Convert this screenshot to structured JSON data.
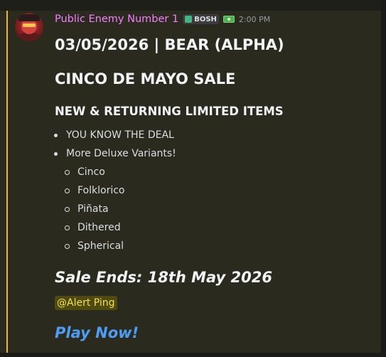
{
  "author": {
    "username": "Public Enemy Number 1",
    "tag_label": "BOSH",
    "tag_icon": "green-badge-icon",
    "badge_icon": "money-icon",
    "timestamp": "2:00 PM",
    "avatar_icon": "avatar-image",
    "username_color": "#f47fff"
  },
  "message": {
    "heading_1": "03/05/2026 | BEAR (ALPHA)",
    "heading_2": "CINCO DE MAYO SALE",
    "heading_3": "NEW & RETURNING LIMITED ITEMS",
    "bullets": [
      "YOU KNOW THE DEAL",
      "More Deluxe Variants!"
    ],
    "sub_bullets": [
      "Cinco",
      "Folklorico",
      "Piñata",
      "Dithered",
      "Spherical"
    ],
    "sale_ends": "Sale Ends: 18th May 2026",
    "role_mention": "@Alert Ping",
    "link_text": "Play Now!"
  },
  "colors": {
    "mention_highlight_bar": "#f0b232",
    "background": "#2b2a1f",
    "link": "#4f9df3",
    "role_mention_text": "#f4e04d"
  }
}
